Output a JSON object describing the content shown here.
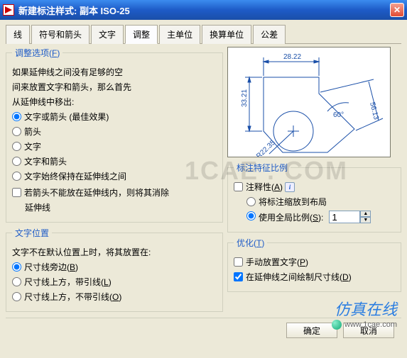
{
  "title": "新建标注样式: 副本 ISO-25",
  "watermark": "1CAE . COM",
  "logo_text": "仿真在线",
  "logo_url": "www.1cae.com",
  "tabs": [
    "线",
    "符号和箭头",
    "文字",
    "调整",
    "主单位",
    "换算单位",
    "公差"
  ],
  "active_tab": 3,
  "fit_options": {
    "legend": "调整选项",
    "legend_key": "F",
    "intro1": "如果延伸线之间没有足够的空",
    "intro2": "间来放置文字和箭头，那么首先",
    "intro3": "从延伸线中移出:",
    "r1": "文字或箭头 (最佳效果)",
    "r2": "箭头",
    "r3": "文字",
    "r4": "文字和箭头",
    "r5": "文字始终保持在延伸线之间",
    "cb": "若箭头不能放在延伸线内，则将其消除",
    "cb2": "延伸线"
  },
  "text_placement": {
    "legend": "文字位置",
    "intro": "文字不在默认位置上时，将其放置在:",
    "r1": "尺寸线旁边",
    "r1_key": "B",
    "r2": "尺寸线上方，带引线",
    "r2_key": "L",
    "r3": "尺寸线上方，不带引线",
    "r3_key": "O"
  },
  "scale_features": {
    "legend": "标注特征比例",
    "cb1": "注释性",
    "cb1_key": "A",
    "r1": "将标注缩放到布局",
    "r2": "使用全局比例",
    "r2_key": "S",
    "scale_value": "1"
  },
  "fine_tuning": {
    "legend": "优化",
    "legend_key": "T",
    "cb1": "手动放置文字",
    "cb1_key": "P",
    "cb2": "在延伸线之间绘制尺寸线",
    "cb2_key": "D"
  },
  "preview_dims": {
    "top": "28.22",
    "left": "33.21",
    "angle": "60°",
    "diag": "56.13",
    "radius": "R22.35"
  },
  "buttons": {
    "ok": "确定",
    "cancel": "取消"
  }
}
